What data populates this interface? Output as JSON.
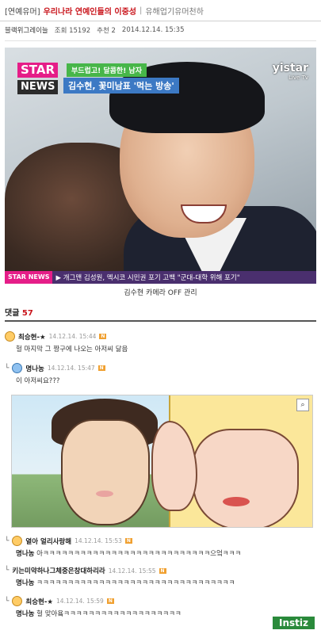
{
  "header": {
    "category": "[연예유머]",
    "title": "우리나라 연예인들의 이중성",
    "tag": "유해업기유머천하"
  },
  "meta": {
    "author": "블랙위그레이늘",
    "views": "조회 15192",
    "recommends": "추천 2",
    "date": "2014.12.14. 15:35"
  },
  "photo": {
    "logo_top": "STAR",
    "logo_bottom": "NEWS",
    "caption_small": "부드럽고! 달콤한! 남자",
    "caption_big": "김수현, 꽃미남표 '먹는 방송'",
    "brand": "yistar",
    "brand_sub": "Live Tv",
    "ticker_logo": "STAR NEWS",
    "ticker_text": "▶ 개그맨 김성원, 멕시코 시민권 포기 고백 \"군대-대학 위해 포기\""
  },
  "photo_caption": "김수현 카메라 OFF 관리",
  "comments_header": {
    "label": "댓글",
    "count": "57"
  },
  "comments": [
    {
      "name": "최승현-★",
      "date": "14.12.14. 15:44",
      "body": "헐 마지막 그 짱구에 나오는 아저씨 닮음",
      "reply": false
    },
    {
      "name": "명나농",
      "date": "14.12.14. 15:47",
      "body": "이 아저씨요???",
      "reply": true
    },
    {
      "name": "열아 얼리사랑해",
      "date": "14.12.14. 15:53",
      "body": "아ㅋㅋㅋㅋㅋㅋㅋㅋㅋㅋㅋㅋㅋㅋㅋㅋㅋㅋㅋㅋㅋㅋㅋㅋㅋㅋㅋ으엌ㅋㅋㅋ",
      "sub": "명나농",
      "reply": true
    },
    {
      "name": "키는미약하나그체중은창대하리라",
      "date": "14.12.14. 15:55",
      "body": "ㅋㅋㅋㅋㅋㅋㅋㅋㅋㅋㅋㅋㅋㅋㅋㅋㅋㅋㅋㅋㅋㅋㅋㅋㅋㅋㅋㅋㅋㅋㅋㅋ",
      "sub": "명나농",
      "reply": true
    },
    {
      "name": "최승현-★",
      "date": "14.12.14. 15:59",
      "body": "헐 맞아욬ㅋㅋㅋㅋㅋㅋㅋㅋㅋㅋㅋㅋㅋㅋㅋㅋㅋㅋㅋ",
      "sub": "명나농",
      "reply": true
    }
  ],
  "watermark": "Instiz",
  "colors": {
    "accent": "#c9141b",
    "star_pink": "#e51d88",
    "ticker_purple": "#4a2f6e"
  }
}
